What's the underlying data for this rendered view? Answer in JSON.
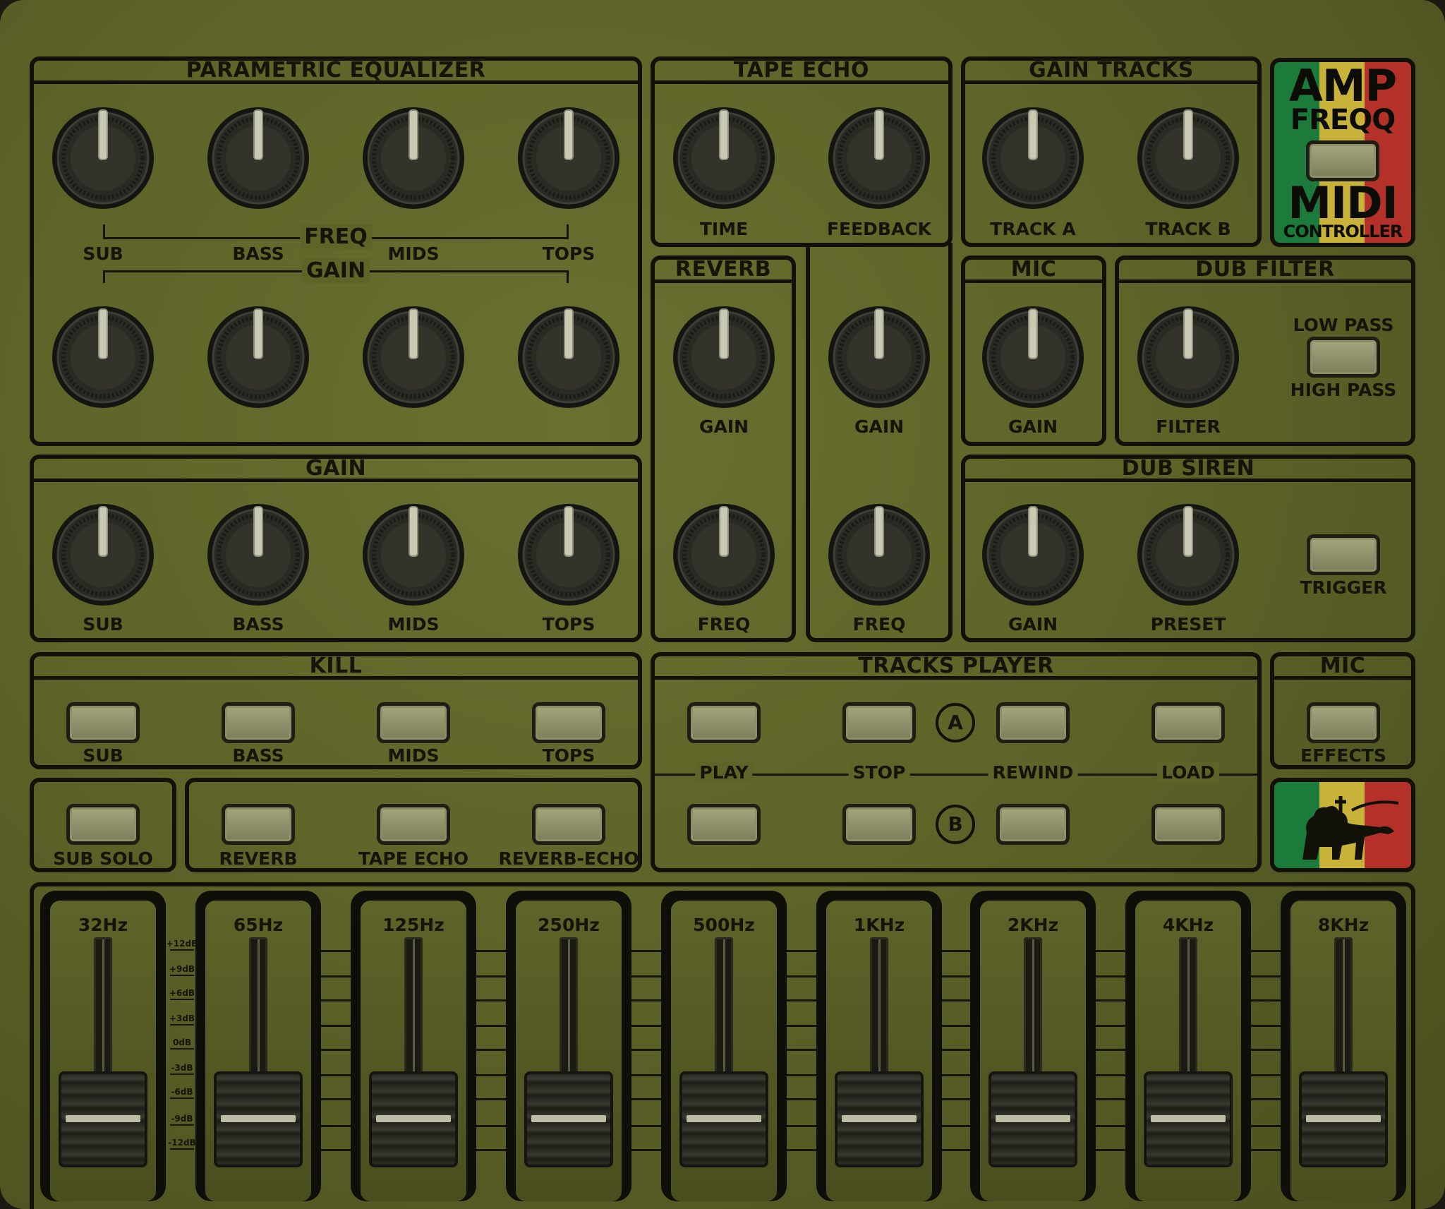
{
  "eq": {
    "title": "PARAMETRIC EQUALIZER",
    "freq_label": "FREQ",
    "gain_label": "GAIN",
    "bands": [
      "SUB",
      "BASS",
      "MIDS",
      "TOPS"
    ]
  },
  "tape_echo": {
    "title": "TAPE ECHO",
    "time": "TIME",
    "feedback": "FEEDBACK",
    "gain": "GAIN",
    "freq": "FREQ"
  },
  "gain_tracks": {
    "title": "GAIN TRACKS",
    "track_a": "TRACK A",
    "track_b": "TRACK B"
  },
  "logo": {
    "line1": "AMP",
    "line2": "FREQQ",
    "line3": "MIDI",
    "line4": "CONTROLLER"
  },
  "reverb": {
    "title": "REVERB",
    "gain": "GAIN",
    "freq": "FREQ"
  },
  "mic": {
    "title": "MIC",
    "gain": "GAIN"
  },
  "dub_filter": {
    "title": "DUB FILTER",
    "filter": "FILTER",
    "low_pass": "LOW PASS",
    "high_pass": "HIGH PASS"
  },
  "gain": {
    "title": "GAIN",
    "bands": [
      "SUB",
      "BASS",
      "MIDS",
      "TOPS"
    ]
  },
  "dub_siren": {
    "title": "DUB SIREN",
    "gain": "GAIN",
    "preset": "PRESET",
    "trigger": "TRIGGER"
  },
  "kill": {
    "title": "KILL",
    "bands": [
      "SUB",
      "BASS",
      "MIDS",
      "TOPS"
    ]
  },
  "sub_solo": {
    "label": "SUB SOLO"
  },
  "send": {
    "reverb": "REVERB",
    "tape_echo": "TAPE ECHO",
    "reverb_echo": "REVERB-ECHO"
  },
  "tracks_player": {
    "title": "TRACKS PLAYER",
    "deck_a": "A",
    "deck_b": "B",
    "play": "PLAY",
    "stop": "STOP",
    "rewind": "REWIND",
    "load": "LOAD"
  },
  "mic_effects": {
    "title": "MIC",
    "effects": "EFFECTS"
  },
  "graphic_eq": {
    "bands": [
      "32Hz",
      "65Hz",
      "125Hz",
      "250Hz",
      "500Hz",
      "1KHz",
      "2KHz",
      "4KHz",
      "8KHz"
    ],
    "scale": [
      "+12dB",
      "+9dB",
      "+6dB",
      "+3dB",
      "0dB",
      "-3dB",
      "-6dB",
      "-9dB",
      "-12dB"
    ],
    "levels_db": [
      -9,
      -9,
      -9,
      -9,
      -9,
      -9,
      -9,
      -9,
      -9
    ]
  },
  "colors": {
    "panel": "#5e6428",
    "line": "#111108",
    "green": "#1c7a3a",
    "gold": "#c9b23a",
    "red": "#b4312a"
  }
}
